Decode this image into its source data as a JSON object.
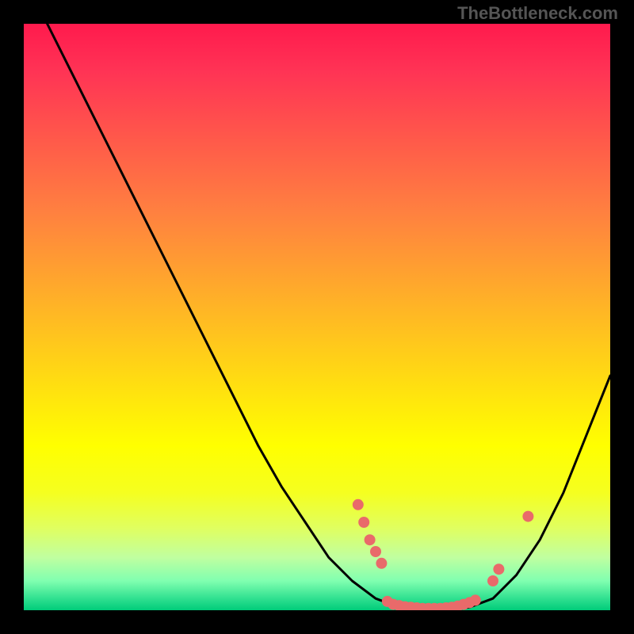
{
  "watermark": "TheBottleneck.com",
  "chart_data": {
    "type": "line",
    "title": "",
    "xlabel": "",
    "ylabel": "",
    "xlim": [
      0,
      100
    ],
    "ylim": [
      0,
      100
    ],
    "curve": [
      {
        "x": 4,
        "y": 100
      },
      {
        "x": 8,
        "y": 92
      },
      {
        "x": 12,
        "y": 84
      },
      {
        "x": 16,
        "y": 76
      },
      {
        "x": 20,
        "y": 68
      },
      {
        "x": 24,
        "y": 60
      },
      {
        "x": 28,
        "y": 52
      },
      {
        "x": 32,
        "y": 44
      },
      {
        "x": 36,
        "y": 36
      },
      {
        "x": 40,
        "y": 28
      },
      {
        "x": 44,
        "y": 21
      },
      {
        "x": 48,
        "y": 15
      },
      {
        "x": 52,
        "y": 9
      },
      {
        "x": 56,
        "y": 5
      },
      {
        "x": 60,
        "y": 2
      },
      {
        "x": 64,
        "y": 0.5
      },
      {
        "x": 68,
        "y": 0
      },
      {
        "x": 72,
        "y": 0
      },
      {
        "x": 76,
        "y": 0.5
      },
      {
        "x": 80,
        "y": 2
      },
      {
        "x": 84,
        "y": 6
      },
      {
        "x": 88,
        "y": 12
      },
      {
        "x": 92,
        "y": 20
      },
      {
        "x": 96,
        "y": 30
      },
      {
        "x": 100,
        "y": 40
      }
    ],
    "markers": [
      {
        "x": 57,
        "y": 18
      },
      {
        "x": 58,
        "y": 15
      },
      {
        "x": 59,
        "y": 12
      },
      {
        "x": 60,
        "y": 10
      },
      {
        "x": 61,
        "y": 8
      },
      {
        "x": 62,
        "y": 1.5
      },
      {
        "x": 63,
        "y": 1
      },
      {
        "x": 64,
        "y": 0.8
      },
      {
        "x": 65,
        "y": 0.6
      },
      {
        "x": 66,
        "y": 0.5
      },
      {
        "x": 67,
        "y": 0.4
      },
      {
        "x": 68,
        "y": 0.3
      },
      {
        "x": 69,
        "y": 0.3
      },
      {
        "x": 70,
        "y": 0.3
      },
      {
        "x": 71,
        "y": 0.3
      },
      {
        "x": 72,
        "y": 0.4
      },
      {
        "x": 73,
        "y": 0.5
      },
      {
        "x": 74,
        "y": 0.7
      },
      {
        "x": 75,
        "y": 1
      },
      {
        "x": 76,
        "y": 1.3
      },
      {
        "x": 77,
        "y": 1.7
      },
      {
        "x": 80,
        "y": 5
      },
      {
        "x": 81,
        "y": 7
      },
      {
        "x": 86,
        "y": 16
      }
    ],
    "colors": {
      "curve": "#000000",
      "marker": "#e96a6a",
      "background_top": "#ff1a4d",
      "background_bottom": "#00cc7a"
    }
  }
}
